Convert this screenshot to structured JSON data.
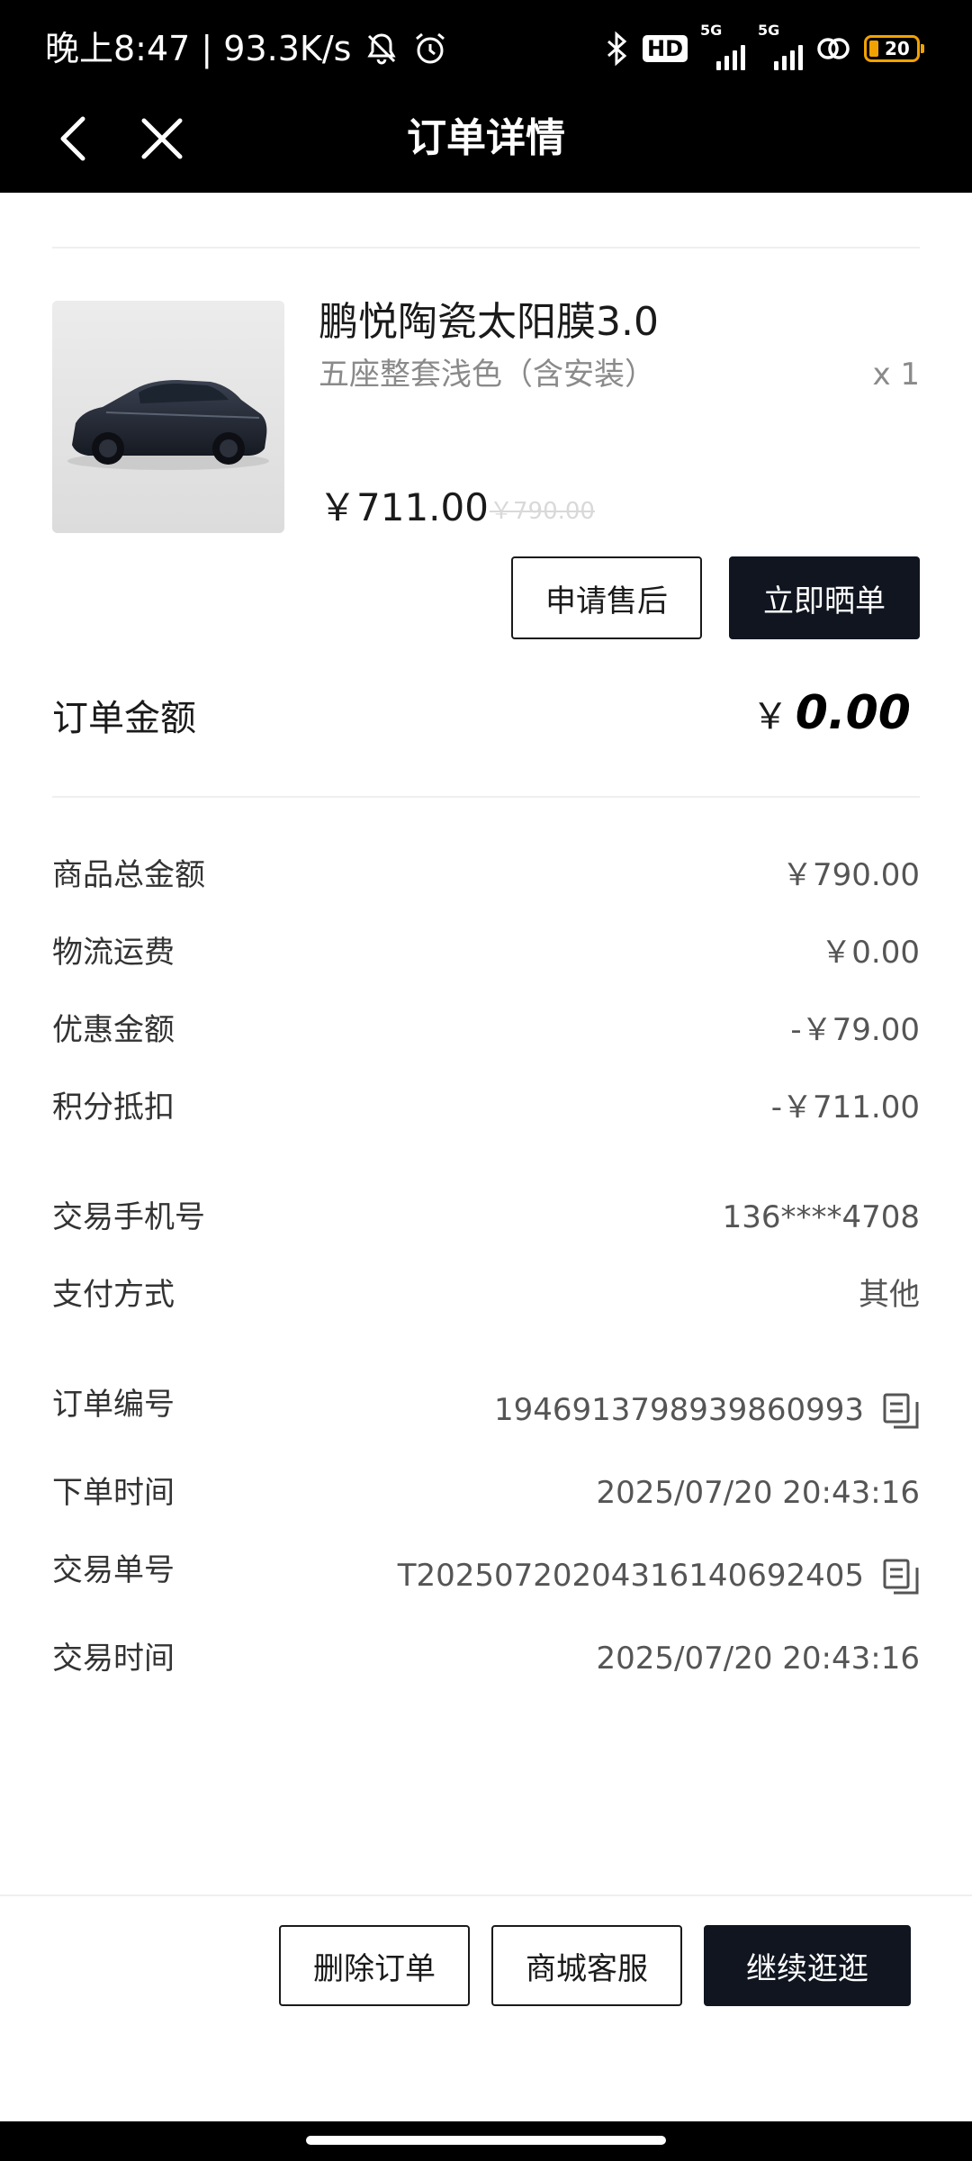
{
  "status_bar": {
    "time_text": "晚上8:47 | 93.3K/s",
    "hd_badge": "HD",
    "sim1_gen": "5G",
    "sim2_gen": "5G",
    "battery": "20"
  },
  "nav": {
    "title": "订单详情"
  },
  "product": {
    "name": "鹏悦陶瓷太阳膜3.0",
    "spec": "五座整套浅色（含安装）",
    "qty": "x 1",
    "price": "￥711.00",
    "original_price": "￥790.00",
    "apply_aftersale_label": "申请售后",
    "share_order_label": "立即晒单"
  },
  "order_amount": {
    "label": "订单金额",
    "currency": "￥",
    "value": "0.00"
  },
  "price_breakdown": [
    {
      "label": "商品总金额",
      "value": "￥790.00"
    },
    {
      "label": "物流运费",
      "value": "￥0.00"
    },
    {
      "label": "优惠金额",
      "value": "-￥79.00"
    },
    {
      "label": "积分抵扣",
      "value": "-￥711.00"
    }
  ],
  "payment_info": [
    {
      "label": "交易手机号",
      "value": "136****4708"
    },
    {
      "label": "支付方式",
      "value": "其他"
    }
  ],
  "order_info": [
    {
      "label": "订单编号",
      "value": "1946913798939860993"
    },
    {
      "label": "下单时间",
      "value": "2025/07/20 20:43:16"
    },
    {
      "label": "交易单号",
      "value": "T2025072020431614069 2405"
    },
    {
      "label": "交易时间",
      "value": "2025/07/20 20:43:16"
    }
  ],
  "footer": {
    "delete_label": "删除订单",
    "service_label": "商城客服",
    "continue_label": "继续逛逛"
  },
  "colors": {
    "dark_button": "#101520",
    "topbar": "#000000",
    "battery": "#f2a200"
  }
}
